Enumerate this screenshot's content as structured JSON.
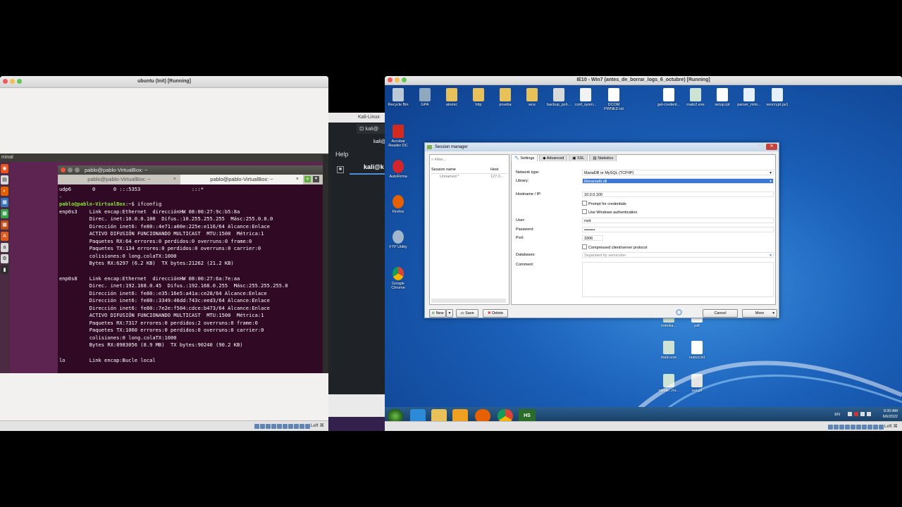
{
  "ubuntu_window": {
    "title": "ubuntu (Init) [Running]",
    "topbar_label": "minal",
    "terminal": {
      "title": "pablo@pablo-VirtualBox: ~",
      "tabs": [
        "pablo@pablo-VirtualBox: ~",
        "pablo@pablo-VirtualBox: ~"
      ],
      "lines": [
        "udp6       0      0 :::5353                 :::*",
        "-",
        "pablo@pablo-VirtualBox:~$ ifconfig",
        "enp0s3    Link encap:Ethernet  direcciónHW 08:00:27:9c:b5:8a",
        "          Direc. inet:10.0.0.100  Difus.:10.255.255.255  Másc:255.0.0.0",
        "          Dirección inet6: fe80::4e71:a00e:225e:e116/64 Alcance:Enlace",
        "          ACTIVO DIFUSIÓN FUNCIONANDO MULTICAST  MTU:1500  Métrica:1",
        "          Paquetes RX:64 errores:0 perdidos:0 overruns:0 frame:0",
        "          Paquetes TX:134 errores:0 perdidos:0 overruns:0 carrier:0",
        "          colisiones:0 long.colaTX:1000",
        "          Bytes RX:6297 (6.2 KB)  TX bytes:21262 (21.2 KB)",
        "",
        "enp0s8    Link encap:Ethernet  direcciónHW 08:00:27:6a:7e:aa",
        "          Direc. inet:192.168.0.45  Difus.:192.168.0.255  Másc:255.255.255.0",
        "          Dirección inet6: fe80::e35:16e5:a41a:ce28/64 Alcance:Enlace",
        "          Dirección inet6: fe80::3349:46dd:743c:eed3/64 Alcance:Enlace",
        "          Dirección inet6: fe80::7e2e:f504:cdce:b473/64 Alcance:Enlace",
        "          ACTIVO DIFUSIÓN FUNCIONANDO MULTICAST  MTU:1500  Métrica:1",
        "          Paquetes RX:7317 errores:0 perdidos:2 overruns:0 frame:0",
        "          Paquetes TX:1060 errores:0 perdidos:0 overruns:0 carrier:0",
        "          colisiones:0 long.colaTX:1000",
        "          Bytes RX:8983056 (8.9 MB)  TX bytes:90240 (90.2 KB)",
        "",
        "lo        Link encap:Bucle local"
      ]
    },
    "status_label": "Left ⌘"
  },
  "kali_window": {
    "title": "Kali-Linux",
    "tab_label": "kali@",
    "help": "Help",
    "prompt": "kali@k",
    "host": "kali@"
  },
  "win7_window": {
    "title": "IE10 - Win7 (antes_de_borrar_logs_6_octubre) [Running]",
    "desktop_icons": [
      {
        "label": "Recycle Bin",
        "icon": "recycle-bin-icon"
      },
      {
        "label": "GPA",
        "icon": "tool-icon"
      },
      {
        "label": "atomic",
        "icon": "folder-icon"
      },
      {
        "label": "http",
        "icon": "folder-icon"
      },
      {
        "label": "prueba",
        "icon": "folder-icon"
      },
      {
        "label": "wce",
        "icon": "folder-icon"
      },
      {
        "label": "backup_psh...",
        "icon": "file-icon"
      },
      {
        "label": "conf_sysm...",
        "icon": "file-icon"
      },
      {
        "label": "DCOM PWNED.txt",
        "icon": "text-file-icon"
      },
      {
        "label": "get-credent...",
        "icon": "file-icon"
      },
      {
        "label": "malo2.exe",
        "icon": "exe-icon"
      },
      {
        "label": "setup.rpt",
        "icon": "file-icon"
      },
      {
        "label": "parser_mim...",
        "icon": "file-icon"
      },
      {
        "label": "xencrypt.ps1",
        "icon": "script-icon"
      },
      {
        "label": "Acrobat Reader DC",
        "icon": "acrobat-icon"
      },
      {
        "label": "AutoFirma",
        "icon": "autofirma-icon"
      },
      {
        "label": "Firefox",
        "icon": "firefox-icon"
      },
      {
        "label": "FTP Utility",
        "icon": "ftp-icon"
      },
      {
        "label": "Google Chrome",
        "icon": "chrome-icon"
      },
      {
        "label": "mimika...",
        "icon": "file-icon"
      },
      {
        "label": "pdf",
        "icon": "file-icon"
      },
      {
        "label": "malo.exe",
        "icon": "exe-icon"
      },
      {
        "label": "nuevo.txt",
        "icon": "text-file-icon"
      },
      {
        "label": "mimik...mi...",
        "icon": "exe-icon"
      },
      {
        "label": "set.gif",
        "icon": "file-icon"
      }
    ],
    "session_manager": {
      "title": "Session manager",
      "filter_placeholder": "Filter...",
      "col_session": "Session name",
      "col_host": "Host",
      "row_session": "Unnamed *",
      "row_host": "127.0...",
      "tabs": [
        "Settings",
        "Advanced",
        "SSL",
        "Statistics"
      ],
      "fields": {
        "network_type_label": "Network type:",
        "network_type_value": "MariaDB or MySQL (TCP/IP)",
        "library_label": "Library:",
        "library_value": "libmariadb.dll",
        "hostname_label": "Hostname / IP:",
        "hostname_value": "10.0.0.100",
        "prompt_credentials": "Prompt for credentials",
        "windows_auth": "Use Windows authentication",
        "user_label": "User:",
        "user_value": "root",
        "password_label": "Password:",
        "password_value": "••••••••",
        "port_label": "Port:",
        "port_value": "3306",
        "compressed": "Compressed client/server protocol",
        "databases_label": "Databases:",
        "databases_placeholder": "Separated by semicolon",
        "comment_label": "Comment:"
      },
      "buttons": {
        "new": "New",
        "save": "Save",
        "delete": "Delete",
        "cancel": "Cancel",
        "more": "More"
      }
    },
    "tray": {
      "lang": "EN",
      "time": "9:30 AM",
      "date": "6/6/2022"
    },
    "status_label": "Left ⌘"
  },
  "colors": {
    "ubuntu_purple": "#5e2750",
    "terminal_bg": "#300a24",
    "prompt_green": "#8ae234",
    "win7_blue": "#1a5fb8"
  }
}
